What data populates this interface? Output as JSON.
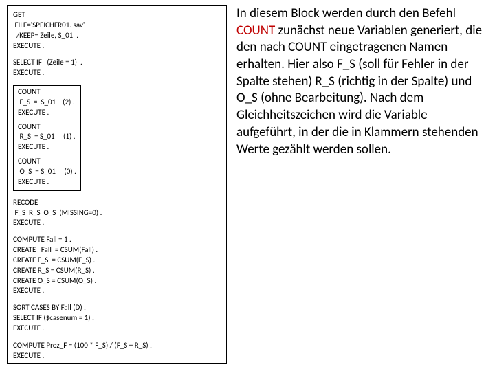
{
  "code": {
    "b1": "GET\n FILE='SPEICHER01. sav'\n  /KEEP= Zeile, S_01  .\nEXECUTE .",
    "b2": "SELECT IF   (Zeile = 1)  .\nEXECUTE .",
    "b3a": "COUNT\n F_S  =  S_01    (2) .\nEXECUTE .",
    "b3b": "COUNT\n R_S  = S_01     (1) .\nEXECUTE .",
    "b3c": "COUNT\n O_S  = S_01     (0) .\nEXECUTE .",
    "b4": "RECODE\n F_S  R_S  O_S  (MISSING=0) .\nEXECUTE .",
    "b5": "COMPUTE Fall = 1 .\nCREATE   Fall  = CSUM(Fall) .\nCREATE F_S  = CSUM(F_S) .\nCREATE R_S = CSUM(R_S) .\nCREATE O_S = CSUM(O_S) .\nEXECUTE .",
    "b6": "SORT CASES BY Fall (D) .\nSELECT IF ($casenum = 1) .\nEXECUTE .",
    "b7": "COMPUTE Proz_F = (100 * F_S) / (F_S + R_S) .\nEXECUTE ."
  },
  "text": {
    "p1a": "In diesem Block werden durch den Befehl ",
    "p1_kw": "COUNT",
    "p1b": "  zunächst neue Variablen generiert, die den nach COUNT eingetragenen Namen erhalten. Hier also F_S (soll für Fehler in der Spalte stehen) R_S (richtig in der Spalte) und O_S (ohne Bearbeitung). Nach dem Gleichheitszeichen wird die Variable aufgeführt, in der die in Klammern stehenden Werte  gezählt werden sollen."
  }
}
